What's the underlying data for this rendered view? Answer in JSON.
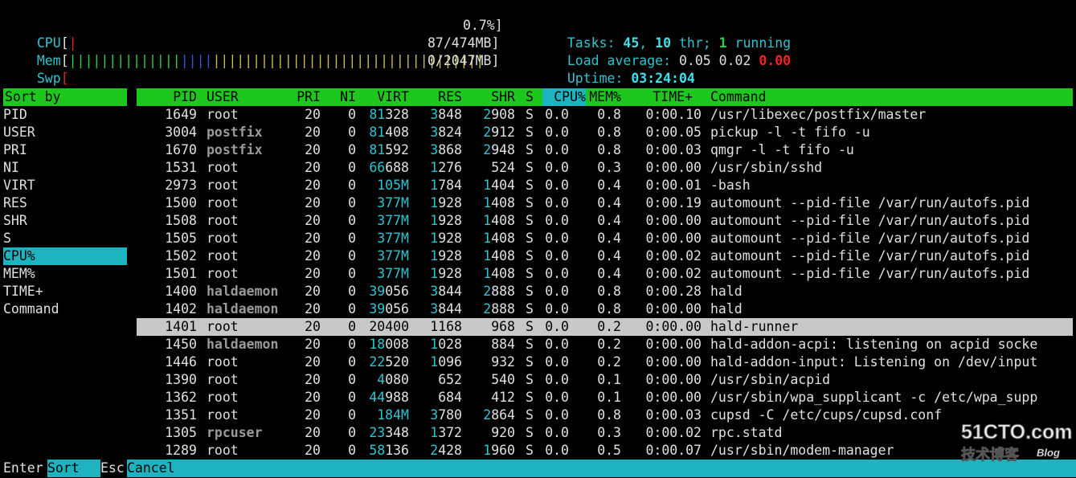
{
  "meters": {
    "cpu": {
      "label": "CPU",
      "bar": "|",
      "value": "0.7%"
    },
    "mem": {
      "label": "Mem",
      "bar_green": "||||||||||||||",
      "bar_blue": "||||",
      "bar_yellow": "||||||||||||||||||||||||||||||||||",
      "value": "87/474MB"
    },
    "swp": {
      "label": "Swp",
      "value": "0/2047MB"
    }
  },
  "summary": {
    "tasks_label": "Tasks: ",
    "tasks": "45",
    "thr": "10",
    "thr_label": " thr; ",
    "running": "1",
    "running_label": " running",
    "load_label": "Load average: ",
    "load1": "0.05",
    "load5": "0.02",
    "load15": "0.00",
    "uptime_label": "Uptime: ",
    "uptime": "03:24:04"
  },
  "sort_panel": {
    "title": "Sort by",
    "items": [
      "PID",
      "USER",
      "PRI",
      "NI",
      "VIRT",
      "RES",
      "SHR",
      "S",
      "CPU%",
      "MEM%",
      "TIME+",
      "Command"
    ],
    "selected": "CPU%"
  },
  "columns": [
    "PID",
    "USER",
    "PRI",
    "NI",
    "VIRT",
    "RES",
    "SHR",
    "S",
    "CPU%",
    "MEM%",
    "TIME+",
    "Command"
  ],
  "processes": [
    {
      "pid": "1649",
      "user": "root",
      "pri": "20",
      "ni": "0",
      "virt": "81328",
      "res": "3848",
      "shr": "2908",
      "s": "S",
      "cpu": "0.0",
      "mem": "0.8",
      "time": "0:00.10",
      "cmd": "/usr/libexec/postfix/master"
    },
    {
      "pid": "3004",
      "user": "postfix",
      "pri": "20",
      "ni": "0",
      "virt": "81408",
      "res": "3824",
      "shr": "2912",
      "s": "S",
      "cpu": "0.0",
      "mem": "0.8",
      "time": "0:00.05",
      "cmd": "pickup -l -t fifo -u"
    },
    {
      "pid": "1670",
      "user": "postfix",
      "pri": "20",
      "ni": "0",
      "virt": "81592",
      "res": "3868",
      "shr": "2948",
      "s": "S",
      "cpu": "0.0",
      "mem": "0.8",
      "time": "0:00.03",
      "cmd": "qmgr -l -t fifo -u"
    },
    {
      "pid": "1531",
      "user": "root",
      "pri": "20",
      "ni": "0",
      "virt": "66688",
      "res": "1276",
      "shr": "524",
      "s": "S",
      "cpu": "0.0",
      "mem": "0.3",
      "time": "0:00.00",
      "cmd": "/usr/sbin/sshd"
    },
    {
      "pid": "2973",
      "user": "root",
      "pri": "20",
      "ni": "0",
      "virt": "105M",
      "res": "1784",
      "shr": "1404",
      "s": "S",
      "cpu": "0.0",
      "mem": "0.4",
      "time": "0:00.01",
      "cmd": "-bash"
    },
    {
      "pid": "1500",
      "user": "root",
      "pri": "20",
      "ni": "0",
      "virt": "377M",
      "res": "1928",
      "shr": "1408",
      "s": "S",
      "cpu": "0.0",
      "mem": "0.4",
      "time": "0:00.19",
      "cmd": "automount --pid-file /var/run/autofs.pid"
    },
    {
      "pid": "1508",
      "user": "root",
      "pri": "20",
      "ni": "0",
      "virt": "377M",
      "res": "1928",
      "shr": "1408",
      "s": "S",
      "cpu": "0.0",
      "mem": "0.4",
      "time": "0:00.00",
      "cmd": "automount --pid-file /var/run/autofs.pid"
    },
    {
      "pid": "1505",
      "user": "root",
      "pri": "20",
      "ni": "0",
      "virt": "377M",
      "res": "1928",
      "shr": "1408",
      "s": "S",
      "cpu": "0.0",
      "mem": "0.4",
      "time": "0:00.00",
      "cmd": "automount --pid-file /var/run/autofs.pid"
    },
    {
      "pid": "1502",
      "user": "root",
      "pri": "20",
      "ni": "0",
      "virt": "377M",
      "res": "1928",
      "shr": "1408",
      "s": "S",
      "cpu": "0.0",
      "mem": "0.4",
      "time": "0:00.02",
      "cmd": "automount --pid-file /var/run/autofs.pid"
    },
    {
      "pid": "1501",
      "user": "root",
      "pri": "20",
      "ni": "0",
      "virt": "377M",
      "res": "1928",
      "shr": "1408",
      "s": "S",
      "cpu": "0.0",
      "mem": "0.4",
      "time": "0:00.02",
      "cmd": "automount --pid-file /var/run/autofs.pid"
    },
    {
      "pid": "1400",
      "user": "haldaemon",
      "pri": "20",
      "ni": "0",
      "virt": "39056",
      "res": "3844",
      "shr": "2888",
      "s": "S",
      "cpu": "0.0",
      "mem": "0.8",
      "time": "0:00.28",
      "cmd": "hald"
    },
    {
      "pid": "1402",
      "user": "haldaemon",
      "pri": "20",
      "ni": "0",
      "virt": "39056",
      "res": "3844",
      "shr": "2888",
      "s": "S",
      "cpu": "0.0",
      "mem": "0.8",
      "time": "0:00.00",
      "cmd": "hald"
    },
    {
      "pid": "1401",
      "user": "root",
      "pri": "20",
      "ni": "0",
      "virt": "20400",
      "res": "1168",
      "shr": "968",
      "s": "S",
      "cpu": "0.0",
      "mem": "0.2",
      "time": "0:00.00",
      "cmd": "hald-runner",
      "selected": true
    },
    {
      "pid": "1450",
      "user": "haldaemon",
      "pri": "20",
      "ni": "0",
      "virt": "18008",
      "res": "1028",
      "shr": "884",
      "s": "S",
      "cpu": "0.0",
      "mem": "0.2",
      "time": "0:00.00",
      "cmd": "hald-addon-acpi: listening on acpid socke"
    },
    {
      "pid": "1446",
      "user": "root",
      "pri": "20",
      "ni": "0",
      "virt": "22520",
      "res": "1096",
      "shr": "932",
      "s": "S",
      "cpu": "0.0",
      "mem": "0.2",
      "time": "0:00.00",
      "cmd": "hald-addon-input: Listening on /dev/input"
    },
    {
      "pid": "1390",
      "user": "root",
      "pri": "20",
      "ni": "0",
      "virt": "4080",
      "res": "652",
      "shr": "540",
      "s": "S",
      "cpu": "0.0",
      "mem": "0.1",
      "time": "0:00.00",
      "cmd": "/usr/sbin/acpid"
    },
    {
      "pid": "1362",
      "user": "root",
      "pri": "20",
      "ni": "0",
      "virt": "44988",
      "res": "684",
      "shr": "412",
      "s": "S",
      "cpu": "0.0",
      "mem": "0.1",
      "time": "0:00.00",
      "cmd": "/usr/sbin/wpa_supplicant -c /etc/wpa_supp"
    },
    {
      "pid": "1351",
      "user": "root",
      "pri": "20",
      "ni": "0",
      "virt": "184M",
      "res": "3780",
      "shr": "2864",
      "s": "S",
      "cpu": "0.0",
      "mem": "0.8",
      "time": "0:00.03",
      "cmd": "cupsd -C /etc/cups/cupsd.conf"
    },
    {
      "pid": "1305",
      "user": "rpcuser",
      "pri": "20",
      "ni": "0",
      "virt": "23348",
      "res": "1372",
      "shr": "920",
      "s": "S",
      "cpu": "0.0",
      "mem": "0.3",
      "time": "0:00.02",
      "cmd": "rpc.statd"
    },
    {
      "pid": "1289",
      "user": "root",
      "pri": "20",
      "ni": "0",
      "virt": "58136",
      "res": "2428",
      "shr": "1960",
      "s": "S",
      "cpu": "0.0",
      "mem": "0.5",
      "time": "0:00.07",
      "cmd": "/usr/sbin/modem-manager"
    }
  ],
  "footer": {
    "key1": "Enter",
    "label1": "Sort",
    "key2": "Esc",
    "label2": "Cancel"
  },
  "watermark": {
    "line1": "51CTO.com",
    "line2": "技术博客",
    "line3": "Blog"
  },
  "colors": {
    "green_bar": "#1ec71e",
    "cyan_bar": "#1db3bf",
    "selected_row": "#c8c8c8",
    "red": "#e52020"
  }
}
